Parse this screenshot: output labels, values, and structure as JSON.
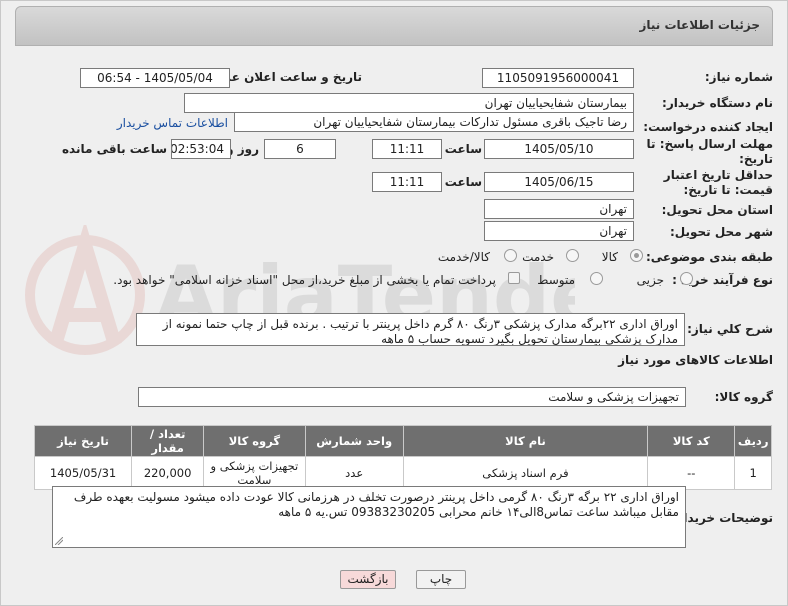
{
  "page_title": "جزئیات اطلاعات نیاز",
  "watermark_brand": "AriaTender.net",
  "fields": {
    "need_number_label": "شماره نیاز:",
    "need_number": "1105091956000041",
    "announce_label": "تاریخ و ساعت اعلان عمومی:",
    "announce_value": "1405/05/04 - 06:54",
    "buyer_org_label": "نام دستگاه خریدار:",
    "buyer_org": "بیمارستان شفایحیاییان تهران",
    "requester_label": "ایجاد کننده درخواست:",
    "requester": "رضا تاجیک باقری مسئول تدارکات بیمارستان شفایحیاییان تهران",
    "buyer_contact_link": "اطلاعات تماس خریدار",
    "deadline_label": "مهلت ارسال پاسخ: تا تاریخ:",
    "deadline_date": "1405/05/10",
    "time_label": "ساعت",
    "deadline_time": "11:11",
    "days_value": "6",
    "days_label": "روز و",
    "remaining_time": "02:53:04",
    "remaining_label": "ساعت باقی مانده",
    "price_validity_label": "حداقل تاریخ اعتبار قیمت: تا تاریخ:",
    "price_validity_date": "1405/06/15",
    "price_validity_time": "11:11",
    "province_label": "استان محل تحویل:",
    "province": "تهران",
    "city_label": "شهر محل تحویل:",
    "city": "تهران",
    "category_label": "طبقه بندی موضوعی:",
    "category_options": [
      "کالا",
      "خدمت",
      "کالا/خدمت"
    ],
    "process_label": "نوع فرآیند خرید :",
    "process_options": [
      "جزیی",
      "متوسط"
    ],
    "payment_text": "پرداخت تمام یا بخشی از مبلغ خرید،از محل \"اسناد خزانه اسلامی\" خواهد بود."
  },
  "description": {
    "label": "شرح کلي نياز:",
    "text": "اوراق اداری ۲۲برگه مدارک پزشکی ۳رنگ ۸۰ گرم داخل پرینتر با ترتیب . برنده قبل از چاپ حتما نمونه از مدارک پزشکی بیمارستان تحویل بگیرد  تسویه حساب ۵ ماهه"
  },
  "goods_section_title": "اطلاعات کالاهای مورد نیاز",
  "goods_group": {
    "label": "گروه کالا:",
    "value": "تجهیزات پزشکی و سلامت"
  },
  "table": {
    "headers": [
      "ردیف",
      "کد کالا",
      "نام کالا",
      "واحد شمارش",
      "گروه کالا",
      "تعداد / مقدار",
      "تاریخ نیاز"
    ],
    "rows": [
      [
        "1",
        "--",
        "فرم اسناد پزشکی",
        "عدد",
        "تجهیزات پزشکی و سلامت",
        "220,000",
        "1405/05/31"
      ]
    ]
  },
  "buyer_notes": {
    "label": "توضیحات خریدار:",
    "text": "اوراق اداری ۲۲ برگه  ۳رنگ ۸۰ گرمی داخل پرینتر درصورت تخلف در هرزمانی کالا  عودت داده میشود مسولیت بعهده طرف مقابل میباشد ساعت تماس8الی۱۴ خانم محرابی 09383230205 تس.یه ۵ ماهه"
  },
  "buttons": {
    "print": "چاپ",
    "back": "بازگشت"
  },
  "colors": {
    "header_bg": "#6f6f6f",
    "link": "#1a4fa0",
    "back_button": "#f7d9d9",
    "print_button": "#f2f2f2"
  }
}
